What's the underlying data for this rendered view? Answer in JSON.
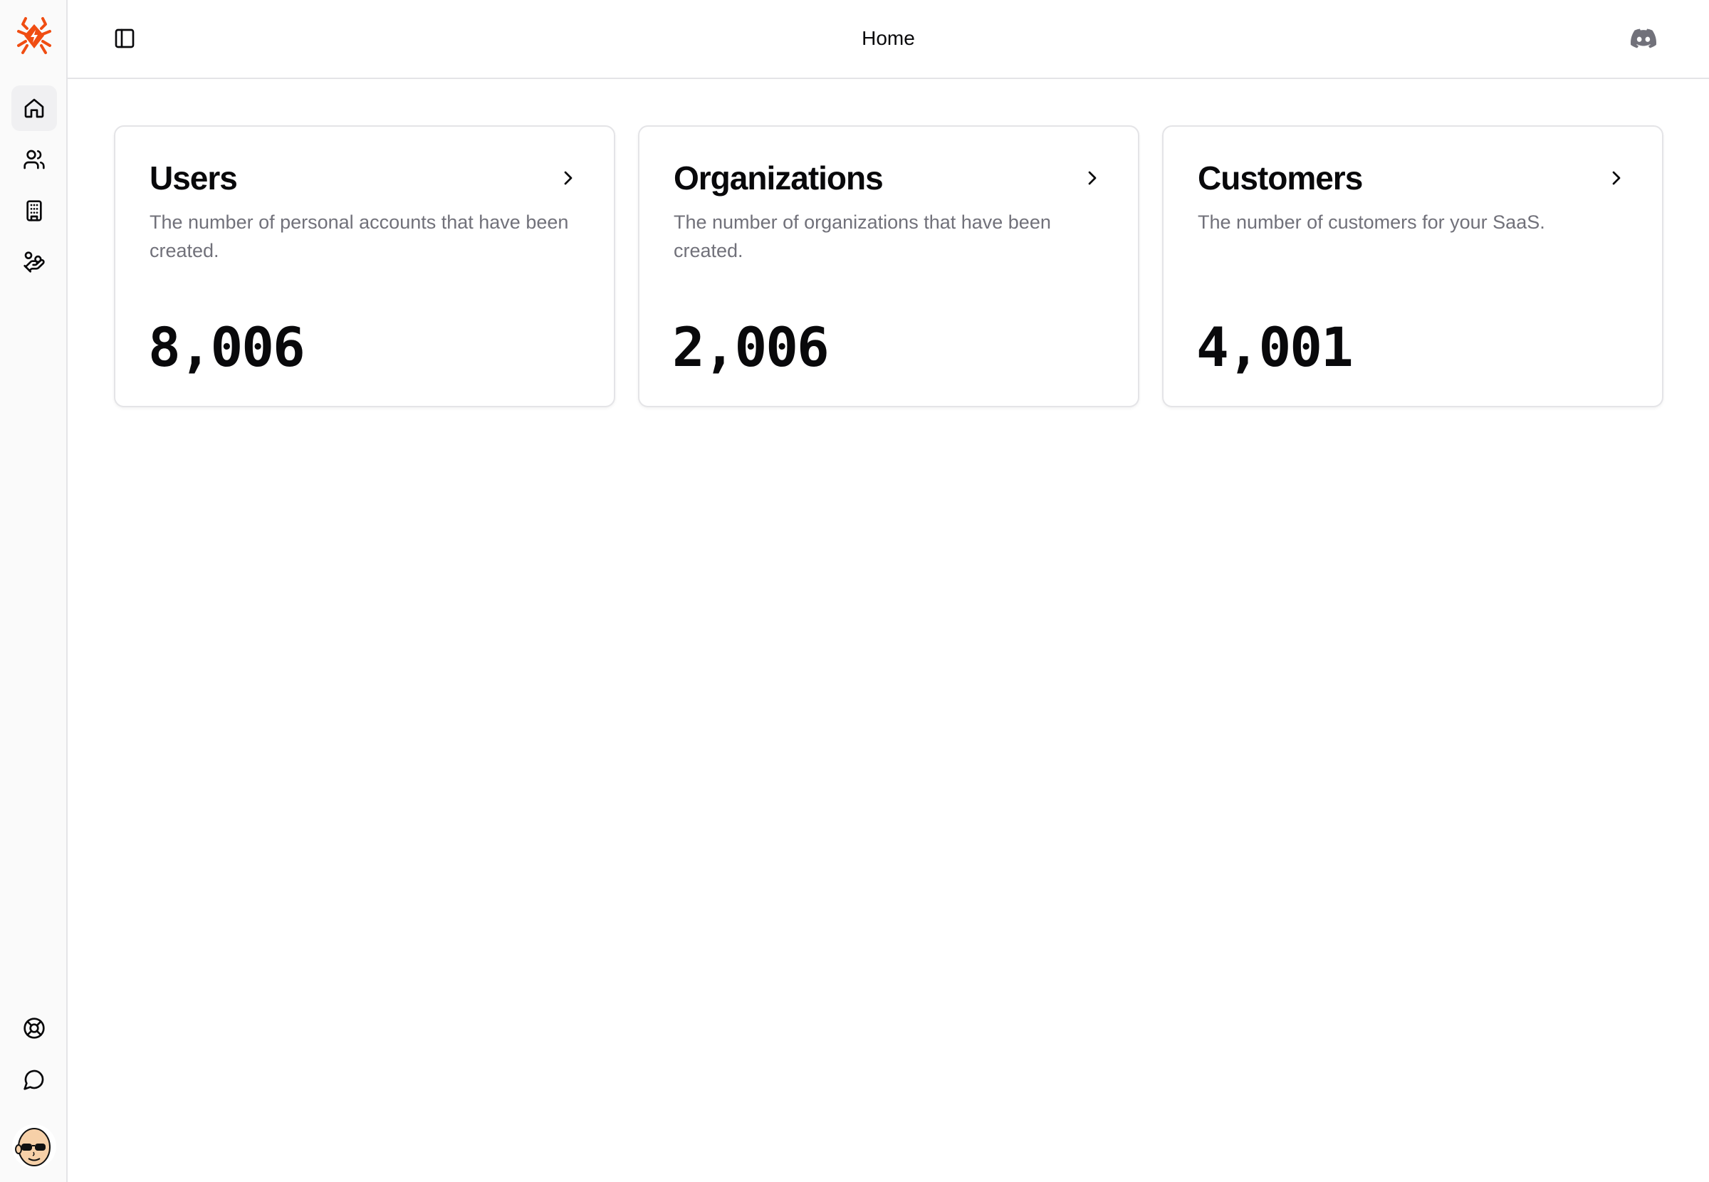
{
  "header": {
    "title": "Home"
  },
  "sidebar": {
    "logo": "spider-logo",
    "items": [
      {
        "name": "home",
        "icon": "home-icon",
        "active": true
      },
      {
        "name": "users",
        "icon": "users-icon",
        "active": false
      },
      {
        "name": "organizations",
        "icon": "building-icon",
        "active": false
      },
      {
        "name": "customers",
        "icon": "hand-coins-icon",
        "active": false
      }
    ],
    "footer_items": [
      {
        "name": "help",
        "icon": "life-buoy-icon"
      },
      {
        "name": "feedback",
        "icon": "message-circle-icon"
      }
    ],
    "avatar": "user-avatar"
  },
  "cards": [
    {
      "title": "Users",
      "description": "The number of personal accounts that have been created.",
      "value": "8,006"
    },
    {
      "title": "Organizations",
      "description": "The number of organizations that have been created.",
      "value": "2,006"
    },
    {
      "title": "Customers",
      "description": "The number of customers for your SaaS.",
      "value": "4,001"
    }
  ],
  "colors": {
    "brand": "#f04d12",
    "text": "#09090b",
    "muted": "#71717a",
    "border": "#e4e4e7",
    "sidebar_bg": "#fafafa",
    "active_bg": "#f0f0f2"
  }
}
